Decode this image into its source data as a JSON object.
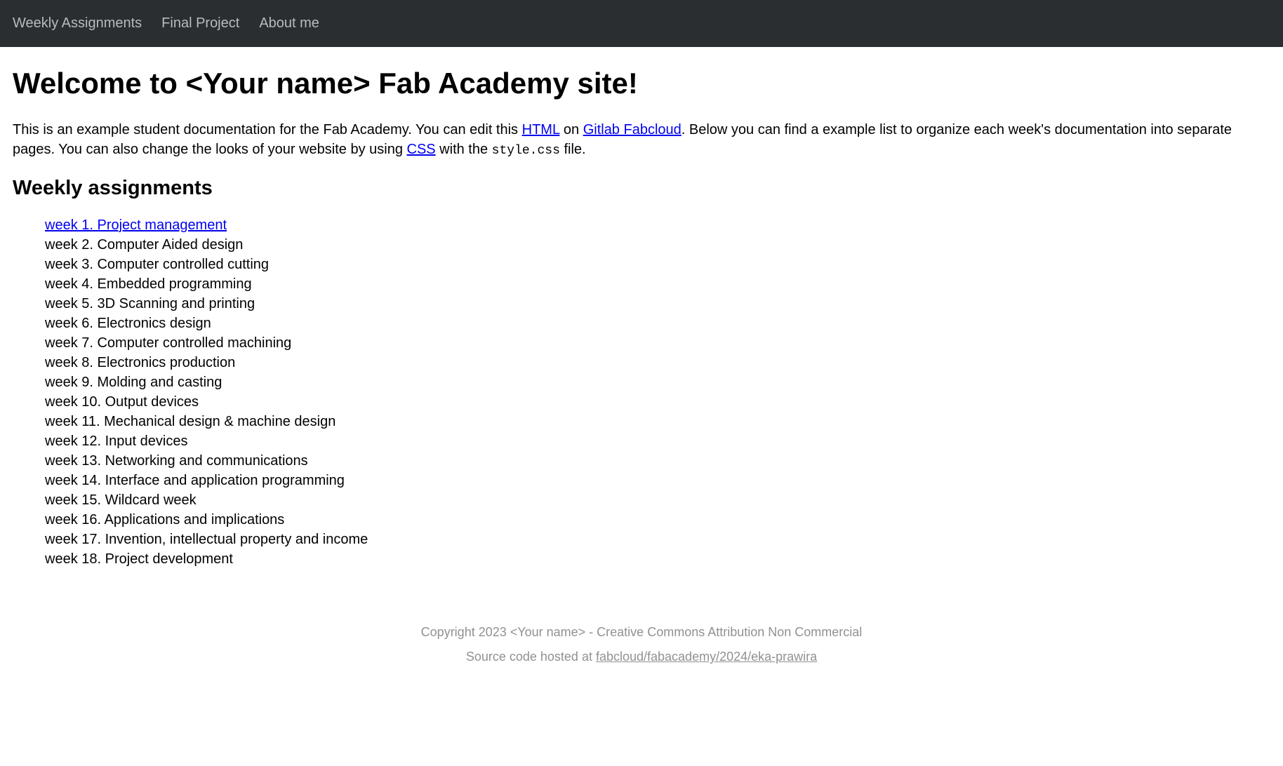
{
  "nav": {
    "weekly": "Weekly Assignments",
    "final": "Final Project",
    "about": "About me"
  },
  "heading": "Welcome to <Your name> Fab Academy site!",
  "intro": {
    "part1": "This is an example student documentation for the Fab Academy. You can edit this ",
    "link_html": "HTML",
    "part2": " on ",
    "link_gitlab": "Gitlab Fabcloud",
    "part3": ". Below you can find a example list to organize each week's documentation into separate pages. You can also change the looks of your website by using ",
    "link_css": "CSS",
    "part4": " with the ",
    "code": "style.css",
    "part5": " file."
  },
  "subheading": "Weekly assignments",
  "weeks": [
    {
      "label": "week 1. Project management",
      "link": true
    },
    {
      "label": "week 2. Computer Aided design",
      "link": false
    },
    {
      "label": "week 3. Computer controlled cutting",
      "link": false
    },
    {
      "label": "week 4. Embedded programming",
      "link": false
    },
    {
      "label": "week 5. 3D Scanning and printing",
      "link": false
    },
    {
      "label": "week 6. Electronics design",
      "link": false
    },
    {
      "label": "week 7. Computer controlled machining",
      "link": false
    },
    {
      "label": "week 8. Electronics production",
      "link": false
    },
    {
      "label": "week 9. Molding and casting",
      "link": false
    },
    {
      "label": "week 10. Output devices",
      "link": false
    },
    {
      "label": "week 11. Mechanical design & machine design",
      "link": false
    },
    {
      "label": "week 12. Input devices",
      "link": false
    },
    {
      "label": "week 13. Networking and communications",
      "link": false
    },
    {
      "label": "week 14. Interface and application programming",
      "link": false
    },
    {
      "label": "week 15. Wildcard week",
      "link": false
    },
    {
      "label": "week 16. Applications and implications",
      "link": false
    },
    {
      "label": "week 17. Invention, intellectual property and income",
      "link": false
    },
    {
      "label": "week 18. Project development",
      "link": false
    }
  ],
  "footer": {
    "copyright": "Copyright 2023 <Your name> - Creative Commons Attribution Non Commercial",
    "source_prefix": "Source code hosted at ",
    "source_link": "fabcloud/fabacademy/2024/eka-prawira"
  }
}
